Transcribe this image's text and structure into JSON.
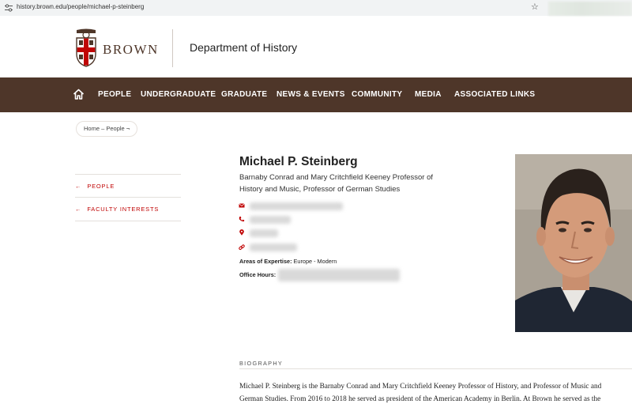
{
  "browser": {
    "url": "history.brown.edu/people/michael-p-steinberg"
  },
  "header": {
    "brand": "BROWN",
    "department": "Department of History"
  },
  "nav": {
    "items": [
      {
        "label": "PEOPLE"
      },
      {
        "label": "UNDERGRADUATE"
      },
      {
        "label": "GRADUATE"
      },
      {
        "label": "NEWS & EVENTS"
      },
      {
        "label": "COMMUNITY"
      },
      {
        "label": "MEDIA"
      },
      {
        "label": "ASSOCIATED LINKS"
      }
    ]
  },
  "breadcrumb": {
    "text": "Home – People ¬"
  },
  "sidebar": {
    "links": [
      {
        "arrow": "←",
        "label": "PEOPLE"
      },
      {
        "arrow": "←",
        "label": "FACULTY INTERESTS"
      }
    ]
  },
  "profile": {
    "name": "Michael P. Steinberg",
    "title_line1": "Barnaby Conrad and Mary Critchfield Keeney Professor of",
    "title_line2": "History and Music, Professor of German Studies",
    "expertise_label": "Areas of Expertise:",
    "expertise_value": "Europe - Modern",
    "office_hours_label": "Office Hours:"
  },
  "biography": {
    "heading": "BIOGRAPHY",
    "line1": "Michael P. Steinberg is the Barnaby Conrad and Mary Critchfield Keeney Professor of History, and Professor of Music and",
    "line2": "German Studies. From 2016 to 2018 he served as president of the American Academy in Berlin. At Brown he served as the"
  },
  "colors": {
    "brown": "#4e3629",
    "red": "#c00404"
  },
  "icons": [
    "tune-icon",
    "star-icon",
    "home-icon",
    "envelope-icon",
    "phone-icon",
    "map-pin-icon",
    "link-icon",
    "left-arrow-icon",
    "brown-shield-logo"
  ]
}
